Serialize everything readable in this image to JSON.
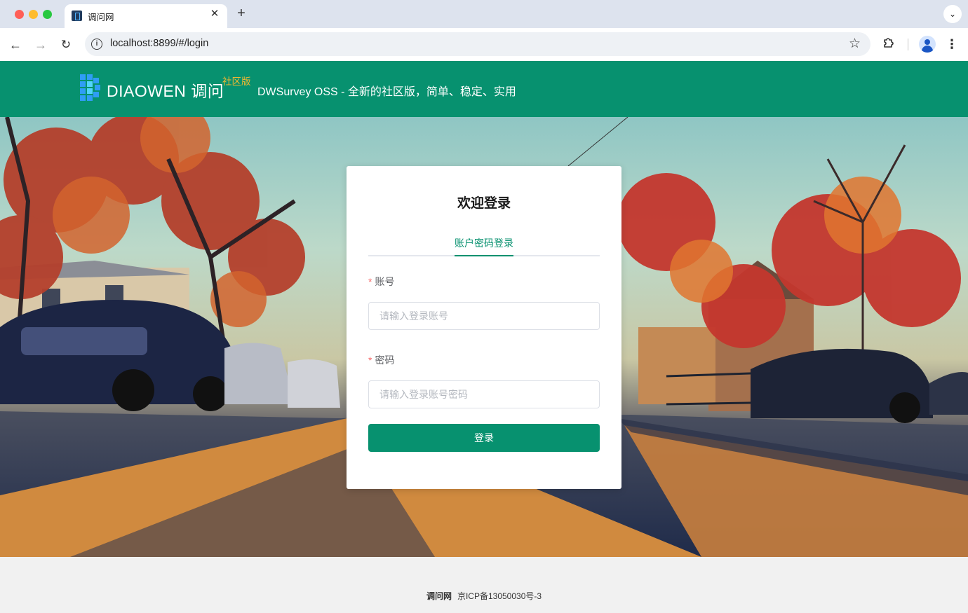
{
  "browser": {
    "tab_title": "调问网",
    "tab_close": "✕",
    "new_tab": "+",
    "tab_menu": "⌄",
    "url": "localhost:8899/#/login",
    "icons": [
      "close-icon",
      "plus-icon",
      "chevron-down-icon",
      "back-icon",
      "forward-icon",
      "reload-icon",
      "info-icon",
      "star-icon",
      "extensions-icon",
      "profile-icon",
      "kebab-menu-icon"
    ]
  },
  "header": {
    "logo_text": "DIAOWEN 调问",
    "edition": "社区版",
    "slogan": "DWSurvey OSS - 全新的社区版，简单、稳定、实用",
    "brand_color": "#07916f"
  },
  "login": {
    "title": "欢迎登录",
    "tab_label": "账户密码登录",
    "required_mark": "*",
    "account_label": "账号",
    "account_placeholder": "请输入登录账号",
    "account_value": "",
    "password_label": "密码",
    "password_placeholder": "请输入登录账号密码",
    "password_value": "",
    "submit_label": "登录"
  },
  "footer": {
    "brand": "调问网",
    "icp": "京ICP备13050030号-3"
  }
}
